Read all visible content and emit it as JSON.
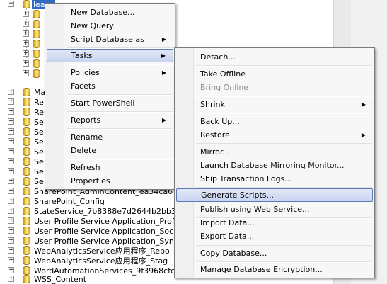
{
  "tree": {
    "selected_label": "leaps",
    "rows": [
      {
        "label": "SharePoint_AdminContent_ea34ca6"
      },
      {
        "label": "SharePoint_Config"
      },
      {
        "label": "StateService_7b8388e7d2644b2bb3"
      },
      {
        "label": "User Profile Service Application_Profi"
      },
      {
        "label": "User Profile Service Application_Socia"
      },
      {
        "label": "User Profile Service Application_Sync"
      },
      {
        "label": "WebAnalyticsService应用程序_Repo"
      },
      {
        "label": "WebAnalyticsService应用程序_Stag"
      },
      {
        "label": "WordAutomationServices_9f3968cfc"
      },
      {
        "label": "WSS_Content"
      }
    ],
    "partial_labels": [
      "Ma",
      "Re",
      "Re",
      "Se",
      "Se",
      "Se",
      "Se",
      "Se",
      "Se",
      "Se"
    ]
  },
  "context_menu": {
    "items": [
      {
        "label": "New Database..."
      },
      {
        "label": "New Query"
      },
      {
        "label": "Script Database as"
      },
      {
        "label": "Tasks"
      },
      {
        "label": "Policies"
      },
      {
        "label": "Facets"
      },
      {
        "label": "Start PowerShell"
      },
      {
        "label": "Reports"
      },
      {
        "label": "Rename"
      },
      {
        "label": "Delete"
      },
      {
        "label": "Refresh"
      },
      {
        "label": "Properties"
      }
    ]
  },
  "tasks_menu": {
    "items": [
      {
        "label": "Detach..."
      },
      {
        "label": "Take Offline"
      },
      {
        "label": "Bring Online"
      },
      {
        "label": "Shrink"
      },
      {
        "label": "Back Up..."
      },
      {
        "label": "Restore"
      },
      {
        "label": "Mirror..."
      },
      {
        "label": "Launch Database Mirroring Monitor..."
      },
      {
        "label": "Ship Transaction Logs..."
      },
      {
        "label": "Generate Scripts..."
      },
      {
        "label": "Publish using Web Service..."
      },
      {
        "label": "Import Data..."
      },
      {
        "label": "Export Data..."
      },
      {
        "label": "Copy Database..."
      },
      {
        "label": "Manage Database Encryption..."
      }
    ]
  },
  "glyphs": {
    "submenu_arrow": "▶",
    "plus": "+",
    "minus": "−"
  },
  "colors": {
    "selection": "#316ac5",
    "highlight_border": "#5b7bb8",
    "db_icon": "#f6d34e"
  }
}
